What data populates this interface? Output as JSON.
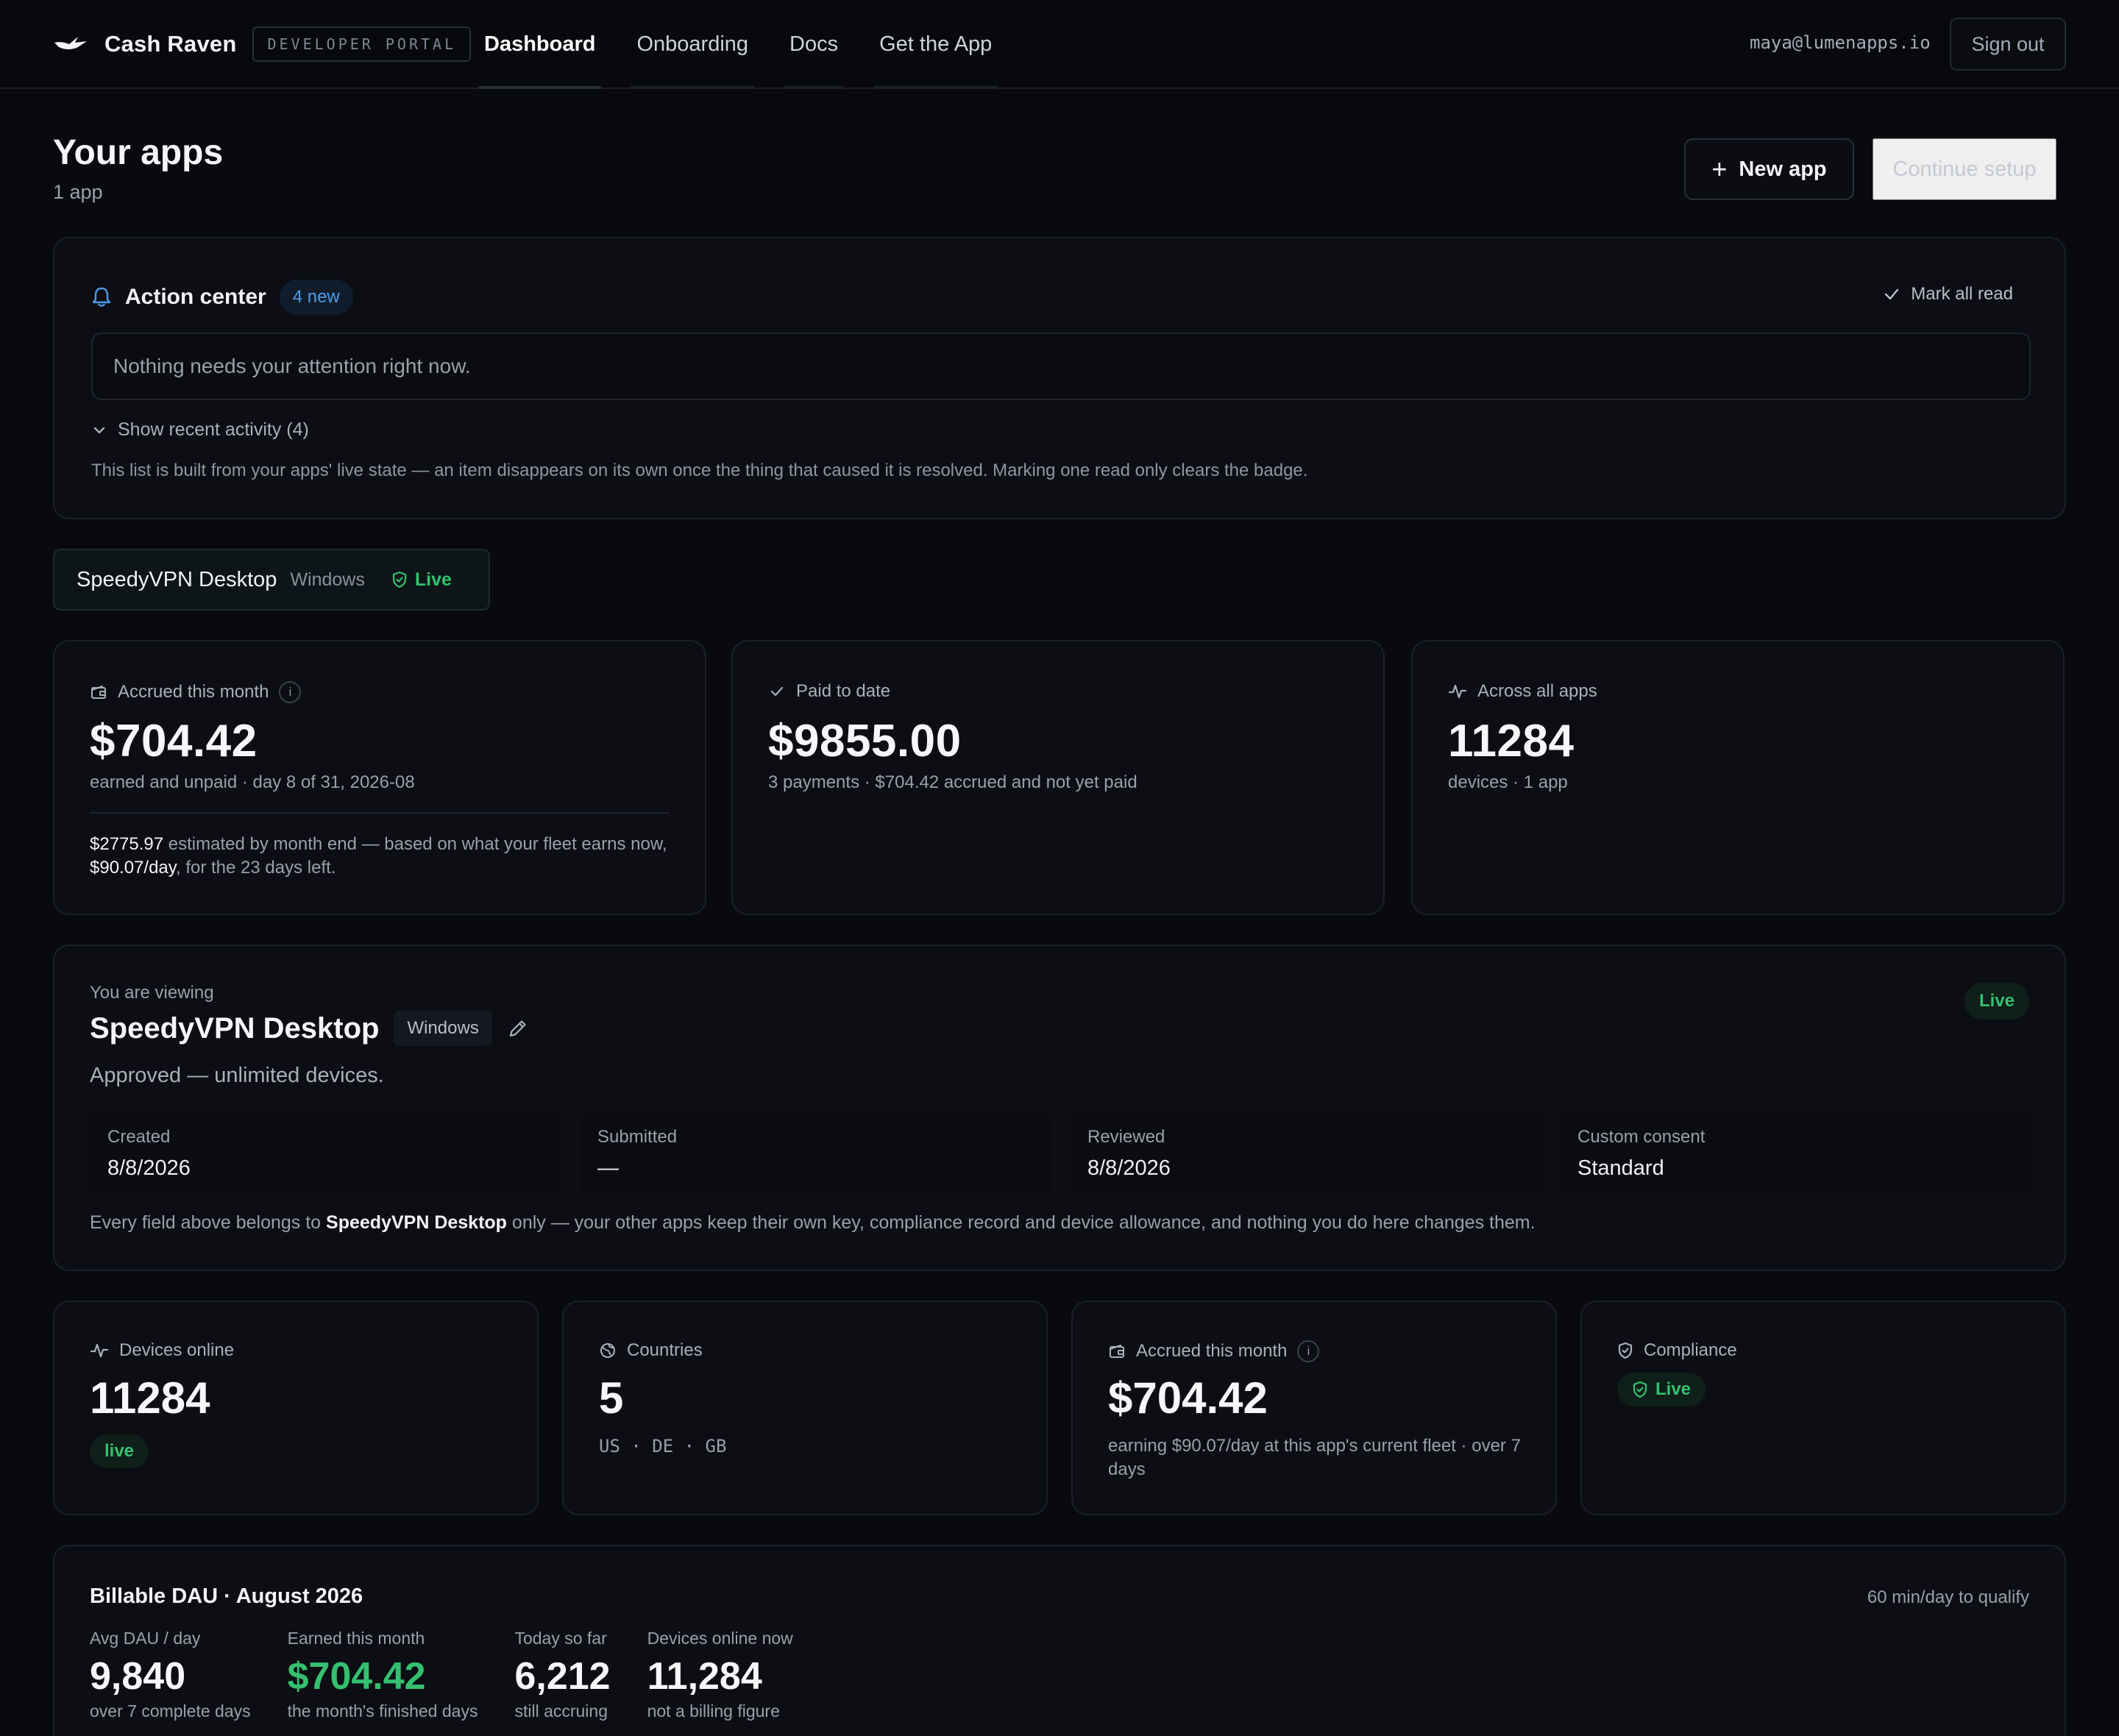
{
  "brand": {
    "name": "Cash Raven",
    "portal_badge": "DEVELOPER PORTAL",
    "logo_icon": "raven-icon"
  },
  "nav": {
    "items": [
      "Dashboard",
      "Onboarding",
      "Docs",
      "Get the App"
    ],
    "active": "Dashboard"
  },
  "user": {
    "email": "maya@lumenapps.io",
    "sign_out": "Sign out"
  },
  "header": {
    "title": "Your apps",
    "subtitle": "1 app",
    "new_app": "New app",
    "continue_setup": "Continue setup"
  },
  "action_center": {
    "title": "Action center",
    "badge": "4 new",
    "mark_all_read": "Mark all read",
    "empty_message": "Nothing needs your attention right now.",
    "show_recent": "Show recent activity (4)",
    "note": "This list is built from your apps' live state — an item disappears on its own once the thing that caused it is resolved. Marking one read only clears the badge."
  },
  "app_chip": {
    "name": "SpeedyVPN Desktop",
    "platform": "Windows",
    "status": "Live"
  },
  "summary": {
    "accrued": {
      "label": "Accrued this month",
      "info": "i",
      "value": "$704.42",
      "sub": "earned and unpaid · day 8 of 31, 2026-08",
      "estimate_amount": "$2775.97",
      "estimate_text_1": " estimated by month end — based on what your fleet earns now, ",
      "estimate_rate": "$90.07/day",
      "estimate_text_2": ", for the 23 days left."
    },
    "paid": {
      "label": "Paid to date",
      "value": "$9855.00",
      "sub": "3 payments · $704.42 accrued and not yet paid"
    },
    "across": {
      "label": "Across all apps",
      "value": "11284",
      "sub": "devices · 1 app"
    }
  },
  "viewing": {
    "kicker": "You are viewing",
    "title": "SpeedyVPN Desktop",
    "platform": "Windows",
    "status": "Live",
    "description": "Approved — unlimited devices.",
    "meta": [
      {
        "label": "Created",
        "value": "8/8/2026"
      },
      {
        "label": "Submitted",
        "value": "—"
      },
      {
        "label": "Reviewed",
        "value": "8/8/2026"
      },
      {
        "label": "Custom consent",
        "value": "Standard"
      }
    ],
    "note_prefix": "Every field above belongs to ",
    "note_app": "SpeedyVPN Desktop",
    "note_suffix": " only — your other apps keep their own key, compliance record and device allowance, and nothing you do here changes them."
  },
  "app_stats": {
    "devices": {
      "label": "Devices online",
      "value": "11284",
      "pill": "live"
    },
    "countries": {
      "label": "Countries",
      "value": "5",
      "sub": "US · DE · GB"
    },
    "accrued": {
      "label": "Accrued this month",
      "info": "i",
      "value": "$704.42",
      "sub": "earning $90.07/day at this app's current fleet · over 7 days"
    },
    "compliance": {
      "label": "Compliance",
      "pill": "Live"
    }
  },
  "billable_dau": {
    "title": "Billable DAU · August 2026",
    "qualify": "60 min/day to qualify",
    "metrics": [
      {
        "label": "Avg DAU / day",
        "value": "9,840",
        "sub": "over 7 complete days"
      },
      {
        "label": "Earned this month",
        "value": "$704.42",
        "sub": "the month's finished days"
      },
      {
        "label": "Today so far",
        "value": "6,212",
        "sub": "still accruing"
      },
      {
        "label": "Devices online now",
        "value": "11,284",
        "sub": "not a billing figure"
      }
    ]
  },
  "colors": {
    "background": "#080a0e",
    "card": "#0c0e13",
    "accent_green": "#34c070",
    "accent_blue": "#4f9ce8"
  }
}
